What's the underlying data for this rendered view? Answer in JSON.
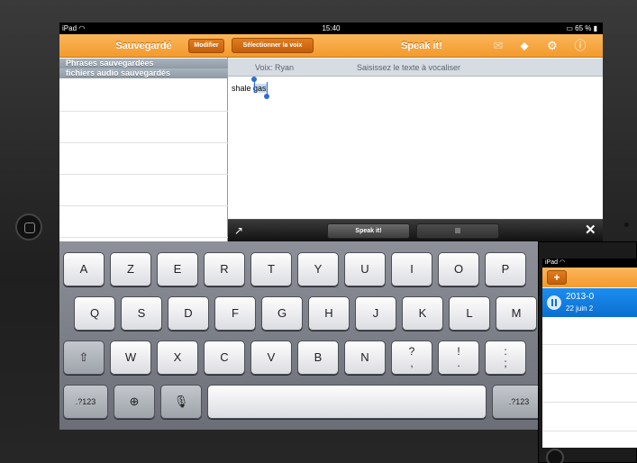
{
  "status_bar": {
    "device": "iPad",
    "wifi_icon": "wifi-icon",
    "time": "15:40",
    "battery": "65 %"
  },
  "left_panel": {
    "title": "Sauvegardé",
    "edit_label": "Modifier",
    "sections": [
      "Phrases sauvegardées",
      "fichiers audio sauvegardés"
    ]
  },
  "right_panel": {
    "voice_button_label": "Sélectionner la voix",
    "title": "Speak it!",
    "voice_label": "Voix: Ryan",
    "prompt_label": "Saisissez le texte à vocaliser",
    "text_before": "shale ",
    "text_selected": "gas",
    "icons": [
      "mail-icon",
      "tag-icon",
      "gears-icon",
      "info-icon"
    ]
  },
  "toolbar": {
    "speak_label": "Speak it!"
  },
  "keyboard": {
    "row1": [
      "A",
      "Z",
      "E",
      "R",
      "T",
      "Y",
      "U",
      "I",
      "O",
      "P"
    ],
    "row2": [
      "Q",
      "S",
      "D",
      "F",
      "G",
      "H",
      "J",
      "K",
      "L",
      "M"
    ],
    "row3": [
      "W",
      "X",
      "C",
      "V",
      "B",
      "N"
    ],
    "punct": [
      [
        "?",
        ","
      ],
      [
        "!",
        "."
      ],
      [
        ":",
        ";"
      ]
    ],
    "numbers_label": ".?123"
  },
  "overlay": {
    "device": "iPad",
    "add_label": "+",
    "item_title": "2013-0",
    "item_date": "22 juin 2"
  },
  "colors": {
    "accent": "#f39a2c",
    "selection": "#2f6dd1",
    "list_blue": "#0a6fd0"
  }
}
